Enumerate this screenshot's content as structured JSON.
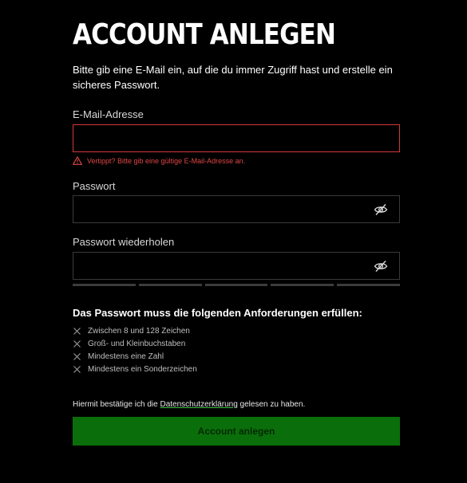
{
  "colors": {
    "background": "#000000",
    "accent": "#0a6e0a",
    "error": "#e04646",
    "text": "#ffffff"
  },
  "page": {
    "title": "ACCOUNT ANLEGEN",
    "intro": "Bitte gib eine E-Mail ein, auf die du immer Zugriff hast und erstelle ein sicheres Passwort."
  },
  "email": {
    "label": "E-Mail-Adresse",
    "value": "",
    "error": "Vertippt? Bitte gib eine gültige E-Mail-Adresse an.",
    "error_icon": "warning-triangle-icon"
  },
  "password": {
    "label": "Passwort",
    "value": "",
    "toggle_icon": "eye-slash-icon"
  },
  "password_repeat": {
    "label": "Passwort wiederholen",
    "value": "",
    "toggle_icon": "eye-slash-icon"
  },
  "strength_meter": {
    "segments_filled": 0,
    "segments_total": 5
  },
  "requirements": {
    "title": "Das Passwort muss die folgenden Anforderungen erfüllen:",
    "items": [
      {
        "text": "Zwischen 8 und 128 Zeichen",
        "icon": "x-icon"
      },
      {
        "text": "Groß- und Kleinbuchstaben",
        "icon": "x-icon"
      },
      {
        "text": "Mindestens eine Zahl",
        "icon": "x-icon"
      },
      {
        "text": "Mindestens ein Sonderzeichen",
        "icon": "x-icon"
      }
    ]
  },
  "consent": {
    "prefix": "Hiermit bestätige ich die ",
    "link": "Datenschutzerklärung",
    "suffix": " gelesen zu haben."
  },
  "submit": {
    "label": "Account anlegen"
  }
}
